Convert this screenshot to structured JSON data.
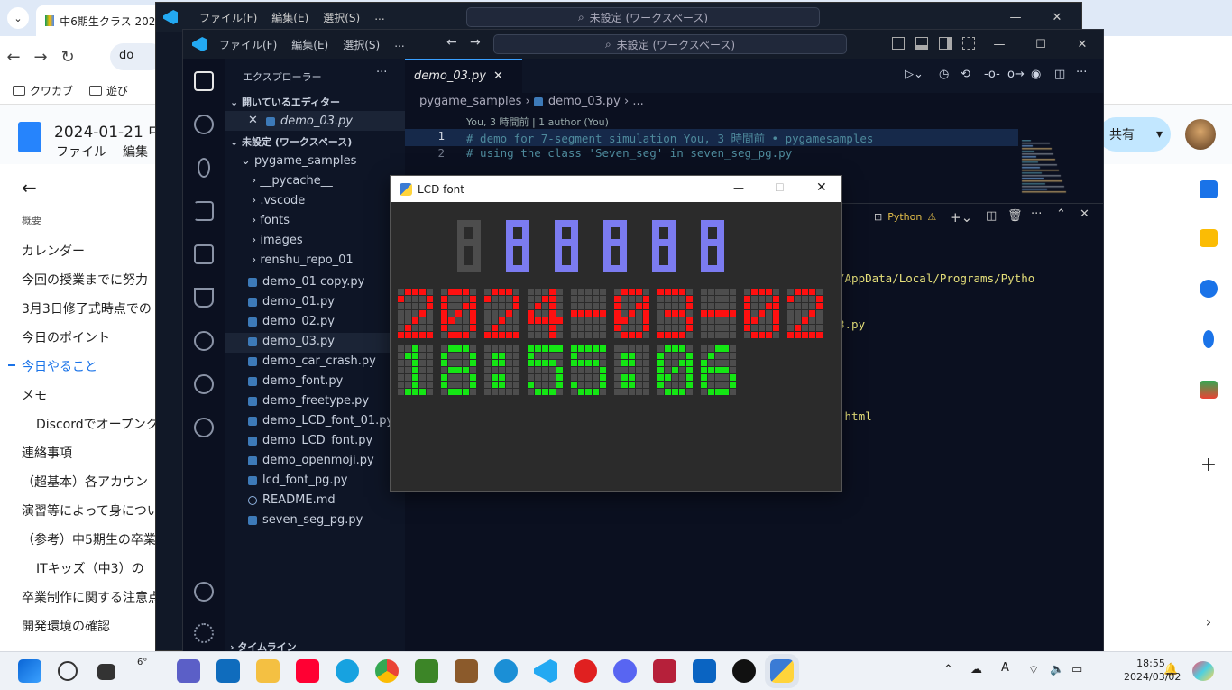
{
  "chrome": {
    "tab_title": "中6期生クラス 2023",
    "omnibox": "do",
    "bookmarks": [
      "クワカブ",
      "遊び"
    ]
  },
  "doc": {
    "title": "2024-01-21 中",
    "menu": [
      "ファイル",
      "編集"
    ],
    "share": "共有",
    "outline_header": "概要",
    "outline": [
      {
        "text": "カレンダー",
        "indent": false,
        "active": false
      },
      {
        "text": "今回の授業までに努力",
        "indent": false,
        "active": false
      },
      {
        "text": "3月3日修了式時点での",
        "indent": false,
        "active": false
      },
      {
        "text": "今日のポイント",
        "indent": false,
        "active": false
      },
      {
        "text": "今日やること",
        "indent": false,
        "active": true
      },
      {
        "text": "メモ",
        "indent": false,
        "active": false
      },
      {
        "text": "Discordでオープンク",
        "indent": true,
        "active": false
      },
      {
        "text": "連絡事項",
        "indent": false,
        "active": false
      },
      {
        "text": "（超基本）各アカウン",
        "indent": false,
        "active": false
      },
      {
        "text": "演習等によって身につい",
        "indent": false,
        "active": false
      },
      {
        "text": "（参考）中5期生の卒業",
        "indent": false,
        "active": false
      },
      {
        "text": "ITキッズ（中3）の",
        "indent": true,
        "active": false
      },
      {
        "text": "卒業制作に関する注意点",
        "indent": false,
        "active": false
      },
      {
        "text": "開発環境の確認",
        "indent": false,
        "active": false
      }
    ]
  },
  "vscode_back": {
    "menu": [
      "ファイル(F)",
      "編集(E)",
      "選択(S)",
      "..."
    ],
    "search": "未設定 (ワークスペース)"
  },
  "vscode": {
    "menu": [
      "ファイル(F)",
      "編集(E)",
      "選択(S)",
      "..."
    ],
    "search": "未設定 (ワークスペース)",
    "explorer_title": "エクスプローラー",
    "open_editors": "開いているエディター",
    "open_file": "demo_03.py",
    "workspace": "未設定 (ワークスペース)",
    "root_folder": "pygame_samples",
    "folders": [
      "__pycache__",
      ".vscode",
      "fonts",
      "images",
      "renshu_repo_01"
    ],
    "files": [
      "demo_01 copy.py",
      "demo_01.py",
      "demo_02.py",
      "demo_03.py",
      "demo_car_crash.py",
      "demo_font.py",
      "demo_freetype.py",
      "demo_LCD_font_01.py",
      "demo_LCD_font.py",
      "demo_openmoji.py",
      "lcd_font_pg.py",
      "README.md",
      "seven_seg_pg.py"
    ],
    "timeline": "タイムライン",
    "tab": "demo_03.py",
    "breadcrumb_folder": "pygame_samples",
    "breadcrumb_file": "demo_03.py",
    "breadcrumb_more": "...",
    "blame": "You, 3 時間前 | 1 author (You)",
    "code": [
      {
        "n": "1",
        "text": "# demo for 7-segment simulation      You, 3 時間前 • pygamesamples"
      },
      {
        "n": "2",
        "text": "# using the class 'Seven_seg' in seven_seg_pg.py"
      }
    ],
    "terminal_profile": "Python",
    "terminal_lines": [
      "/AppData/Local/Programs/Pytho",
      "3.py",
      "",
      ".html"
    ]
  },
  "lcd_window": {
    "title": "LCD font",
    "row1_text": "888888",
    "row2_text": "2024-03-02",
    "row3_text": "18:55:06",
    "colors": {
      "row1": "#7b7bf0",
      "row2": "#ff1010",
      "row3": "#14e614",
      "off": "#4d4d4d"
    }
  },
  "taskbar": {
    "weather": "6°",
    "time": "18:55",
    "date": "2024/03/02"
  }
}
